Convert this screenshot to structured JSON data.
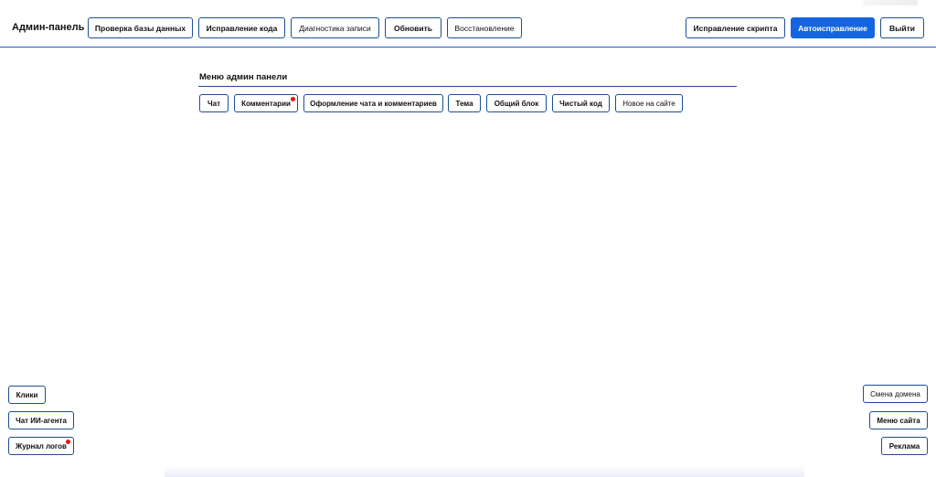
{
  "app": {
    "title": "Админ-панель"
  },
  "header_left": [
    {
      "label": "Проверка базы данных"
    },
    {
      "label": "Исправление кода"
    },
    {
      "label": "Диагностика записи"
    },
    {
      "label": "Обновить"
    },
    {
      "label": "Восстановление"
    }
  ],
  "header_right": {
    "fix_script": "Исправление скрипта",
    "autofix": "Автоисправление",
    "logout": "Выйти"
  },
  "menu": {
    "title": "Меню админ панели",
    "tabs": [
      {
        "label": "Чат"
      },
      {
        "label": "Комментарии",
        "notification": true
      },
      {
        "label": "Оформление чата и комментариев"
      },
      {
        "label": "Тема"
      },
      {
        "label": "Общий блок"
      },
      {
        "label": "Чистый код"
      },
      {
        "label": "Новое на сайте"
      }
    ]
  },
  "sidebar_left": [
    {
      "label": "Клики"
    },
    {
      "label": "Чат ИИ-агента"
    },
    {
      "label": "Журнал логов",
      "notification": true
    }
  ],
  "sidebar_right": [
    {
      "label": "Смена домена"
    },
    {
      "label": "Меню сайта"
    },
    {
      "label": "Реклама"
    }
  ],
  "colors": {
    "accent": "#1565e0",
    "border": "#1d4f91",
    "notification_dot": "#e11111"
  }
}
